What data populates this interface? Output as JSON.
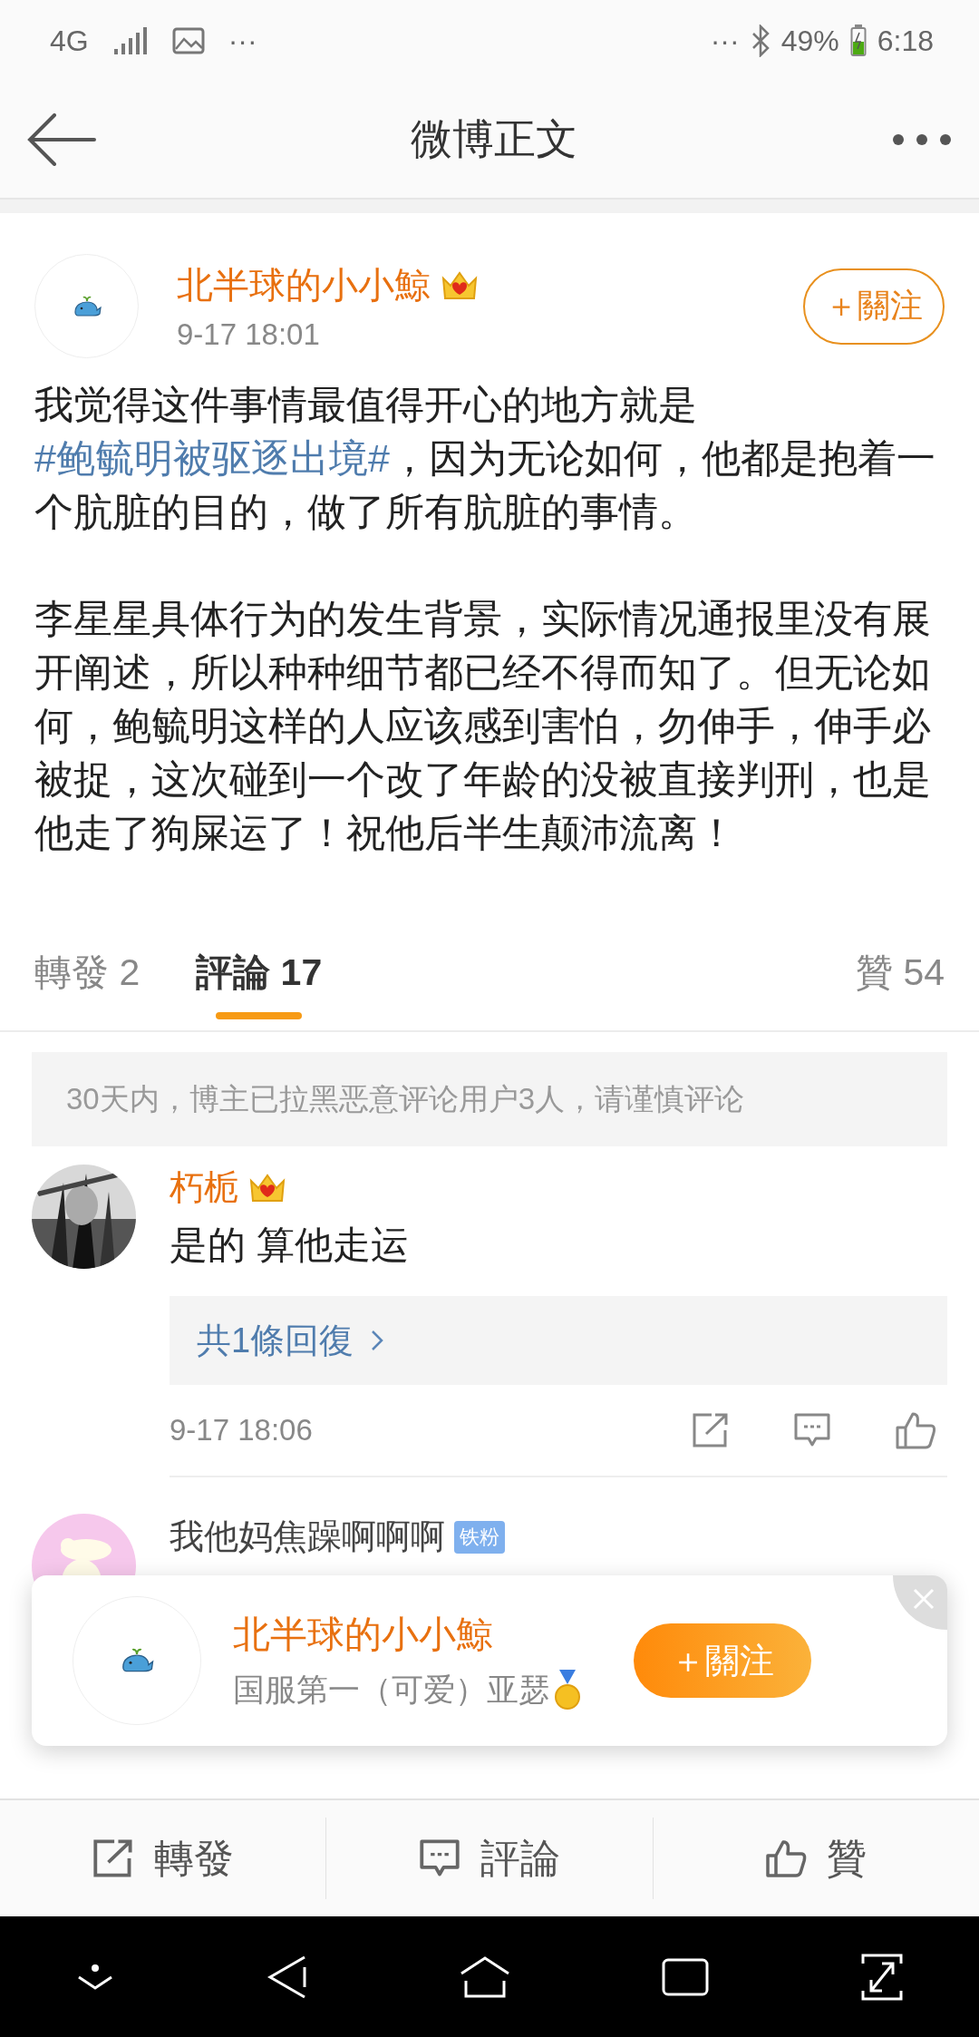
{
  "status_bar": {
    "network": "4G",
    "left_more": "···",
    "right_more": "···",
    "battery": "49%",
    "time": "6:18"
  },
  "header": {
    "title": "微博正文"
  },
  "post": {
    "author": "北半球的小小鯨",
    "time": "9-17 18:01",
    "follow_label": "＋關注",
    "paragraphs": [
      [
        {
          "kind": "text",
          "text": "我觉得这件事情最值得开心的地方就是"
        },
        {
          "kind": "hashtag",
          "text": "#鲍毓明被驱逐出境#"
        },
        {
          "kind": "text",
          "text": "，因为无论如何，他都是抱着一个肮脏的目的，做了所有肮脏的事情。"
        }
      ],
      [
        {
          "kind": "text",
          "text": "李星星具体行为的发生背景，实际情况通报里没有展开阐述，所以种种细节都已经不得而知了。但无论如何，鲍毓明这样的人应该感到害怕，勿伸手，伸手必被捉，这次碰到一个改了年龄的没被直接判刑，也是他走了狗屎运了！祝他后半生颠沛流离！"
        }
      ]
    ]
  },
  "tabs": [
    {
      "label": "轉發",
      "count": "2",
      "selected": false
    },
    {
      "label": "評論",
      "count": "17",
      "selected": true
    },
    {
      "label": "贊",
      "count": "54",
      "selected": false
    }
  ],
  "notice": "30天内，博主已拉黑恶意评论用户3人，请谨慎评论",
  "comments": [
    {
      "author": "朽栀",
      "text": "是的 算他走运",
      "replies": "共1條回復",
      "time": "9-17 18:06"
    },
    {
      "author": "我他妈焦躁啊啊啊",
      "badge": "铁粉"
    }
  ],
  "popup": {
    "name": "北半球的小小鯨",
    "bio": "国服第一（可爱）亚瑟",
    "follow_label": "＋關注"
  },
  "action_bar": [
    {
      "kind": "repost",
      "label": "轉發"
    },
    {
      "kind": "comment",
      "label": "評論"
    },
    {
      "kind": "like",
      "label": "贊"
    }
  ]
}
